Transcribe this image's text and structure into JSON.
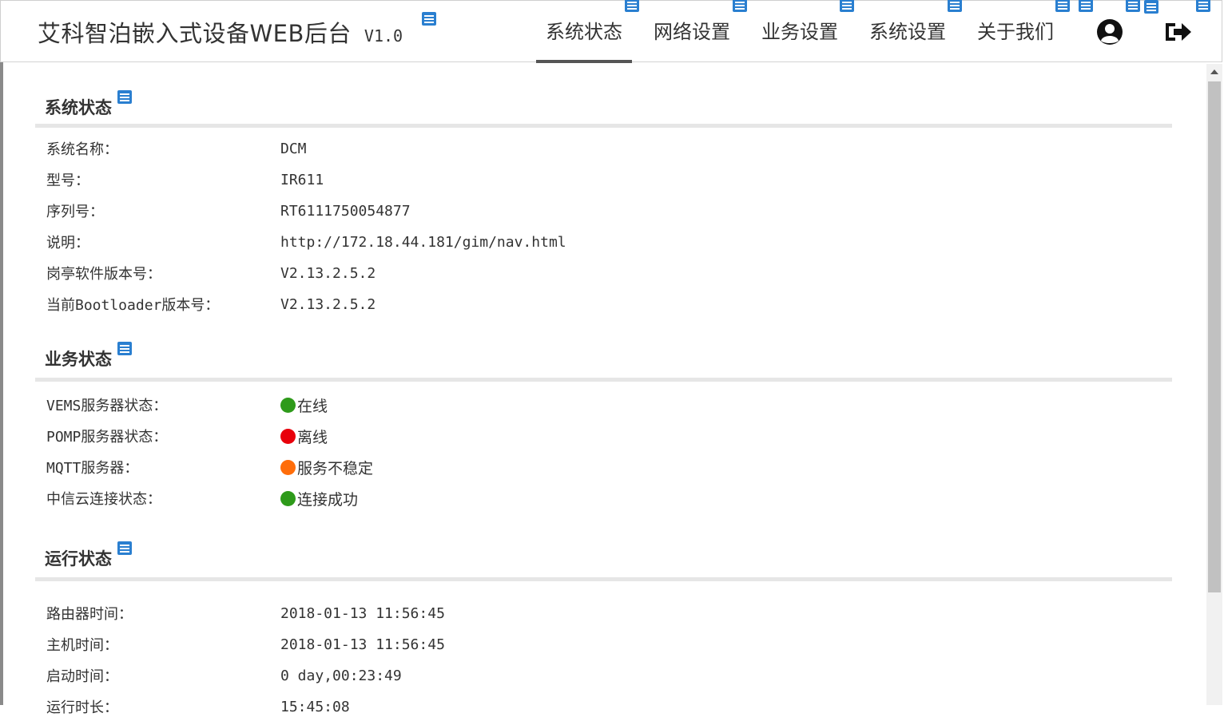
{
  "header": {
    "title": "艾科智泊嵌入式设备WEB后台",
    "version": "V1.0",
    "nav": [
      {
        "label": "系统状态",
        "active": true
      },
      {
        "label": "网络设置",
        "active": false
      },
      {
        "label": "业务设置",
        "active": false
      },
      {
        "label": "系统设置",
        "active": false
      },
      {
        "label": "关于我们",
        "active": false
      }
    ],
    "user_icon": "user-circle-icon",
    "logout_icon": "sign-out-icon",
    "note_icon": "note-icon",
    "note_color": "#2a7fd0"
  },
  "sections": {
    "system": {
      "title": "系统状态",
      "rows": [
        {
          "label": "系统名称：",
          "value": "DCM"
        },
        {
          "label": "型号：",
          "value": "IR611"
        },
        {
          "label": "序列号：",
          "value": "RT6111750054877"
        },
        {
          "label": "说明：",
          "value": "http://172.18.44.181/gim/nav.html"
        },
        {
          "label": "岗亭软件版本号：",
          "value": "V2.13.2.5.2"
        },
        {
          "label": "当前Bootloader版本号：",
          "value": "V2.13.2.5.2"
        }
      ]
    },
    "business": {
      "title": "业务状态",
      "rows": [
        {
          "label": "VEMS服务器状态：",
          "value": "在线",
          "status_color": "#2e9a1a"
        },
        {
          "label": "POMP服务器状态：",
          "value": "离线",
          "status_color": "#e8000b"
        },
        {
          "label": "MQTT服务器：",
          "value": "服务不稳定",
          "status_color": "#ff6d0a"
        },
        {
          "label": "中信云连接状态：",
          "value": "连接成功",
          "status_color": "#2e9a1a"
        }
      ]
    },
    "runtime": {
      "title": "运行状态",
      "rows": [
        {
          "label": "路由器时间：",
          "value": "2018-01-13 11:56:45"
        },
        {
          "label": "主机时间：",
          "value": "2018-01-13 11:56:45"
        },
        {
          "label": "启动时间：",
          "value": "0 day,00:23:49"
        },
        {
          "label": "运行时长：",
          "value": "15:45:08"
        }
      ]
    }
  }
}
